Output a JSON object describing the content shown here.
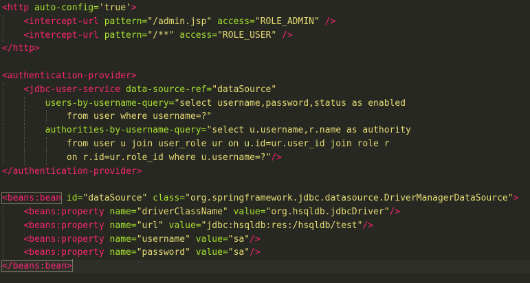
{
  "editor": {
    "lines": [
      [
        {
          "t": "<",
          "c": "tag"
        },
        {
          "t": "http",
          "c": "tag"
        },
        {
          "t": " auto-config=",
          "c": "attr"
        },
        {
          "t": "'true'",
          "c": "str"
        },
        {
          "t": ">",
          "c": "tag"
        }
      ],
      [
        {
          "t": "    "
        },
        {
          "t": "<intercept-url",
          "c": "tag"
        },
        {
          "t": " pattern=",
          "c": "attr"
        },
        {
          "t": "\"/admin.jsp\"",
          "c": "str"
        },
        {
          "t": " access=",
          "c": "attr"
        },
        {
          "t": "\"ROLE_ADMIN\"",
          "c": "str"
        },
        {
          "t": " />",
          "c": "tag"
        }
      ],
      [
        {
          "t": "    "
        },
        {
          "t": "<intercept-url",
          "c": "tag"
        },
        {
          "t": " pattern=",
          "c": "attr"
        },
        {
          "t": "\"/**\"",
          "c": "str"
        },
        {
          "t": " access=",
          "c": "attr"
        },
        {
          "t": "\"ROLE_USER\"",
          "c": "str"
        },
        {
          "t": " />",
          "c": "tag"
        }
      ],
      [
        {
          "t": "</http>",
          "c": "tag"
        }
      ],
      [],
      [
        {
          "t": "<authentication-provider>",
          "c": "tag"
        }
      ],
      [
        {
          "t": "    "
        },
        {
          "t": "<jdbc-user-service",
          "c": "tag"
        },
        {
          "t": " data-source-ref=",
          "c": "attr"
        },
        {
          "t": "\"dataSource\"",
          "c": "str"
        }
      ],
      [
        {
          "t": "        "
        },
        {
          "t": "users-by-username-query=",
          "c": "attr"
        },
        {
          "t": "\"select username,password,status as enabled",
          "c": "str"
        }
      ],
      [
        {
          "t": "            "
        },
        {
          "t": "from user where username=?\"",
          "c": "str"
        }
      ],
      [
        {
          "t": "        "
        },
        {
          "t": "authorities-by-username-query=",
          "c": "attr"
        },
        {
          "t": "\"select u.username,r.name as authority",
          "c": "str"
        }
      ],
      [
        {
          "t": "            "
        },
        {
          "t": "from user u join user_role ur on u.id=ur.user_id join role r",
          "c": "str"
        }
      ],
      [
        {
          "t": "            "
        },
        {
          "t": "on r.id=ur.role_id where u.username=?\"",
          "c": "str"
        },
        {
          "t": "/>",
          "c": "tag"
        }
      ],
      [
        {
          "t": "</authentication-provider>",
          "c": "tag"
        }
      ],
      [],
      [
        {
          "t": "<beans:bean",
          "c": "tag",
          "m": true
        },
        {
          "t": " id=",
          "c": "attr"
        },
        {
          "t": "\"dataSource\"",
          "c": "str"
        },
        {
          "t": " class=",
          "c": "attr"
        },
        {
          "t": "\"org.springframework.jdbc.datasource.DriverManagerDataSource\"",
          "c": "str"
        },
        {
          "t": ">",
          "c": "tag"
        }
      ],
      [
        {
          "t": "    "
        },
        {
          "t": "<beans:property",
          "c": "tag"
        },
        {
          "t": " name=",
          "c": "attr"
        },
        {
          "t": "\"driverClassName\"",
          "c": "str"
        },
        {
          "t": " value=",
          "c": "attr"
        },
        {
          "t": "\"org.hsqldb.jdbcDriver\"",
          "c": "str"
        },
        {
          "t": "/>",
          "c": "tag"
        }
      ],
      [
        {
          "t": "    "
        },
        {
          "t": "<beans:property",
          "c": "tag"
        },
        {
          "t": " name=",
          "c": "attr"
        },
        {
          "t": "\"url\"",
          "c": "str"
        },
        {
          "t": " value=",
          "c": "attr"
        },
        {
          "t": "\"jdbc:hsqldb:res:/hsqldb/test\"",
          "c": "str"
        },
        {
          "t": "/>",
          "c": "tag"
        }
      ],
      [
        {
          "t": "    "
        },
        {
          "t": "<beans:property",
          "c": "tag"
        },
        {
          "t": " name=",
          "c": "attr"
        },
        {
          "t": "\"username\"",
          "c": "str"
        },
        {
          "t": " value=",
          "c": "attr"
        },
        {
          "t": "\"sa\"",
          "c": "str"
        },
        {
          "t": "/>",
          "c": "tag"
        }
      ],
      [
        {
          "t": "    "
        },
        {
          "t": "<beans:property",
          "c": "tag"
        },
        {
          "t": " name=",
          "c": "attr"
        },
        {
          "t": "\"password\"",
          "c": "str"
        },
        {
          "t": " value=",
          "c": "attr"
        },
        {
          "t": "\"sa\"",
          "c": "str"
        },
        {
          "t": "/>",
          "c": "tag"
        }
      ],
      [
        {
          "t": "</beans:bean>",
          "c": "tag",
          "m": true
        }
      ]
    ],
    "cursor_line": 20,
    "colors": {
      "background": "#272822",
      "tag": "#f92672",
      "attribute": "#a6e22e",
      "string": "#e6db74",
      "text": "#f8f8f2"
    }
  }
}
